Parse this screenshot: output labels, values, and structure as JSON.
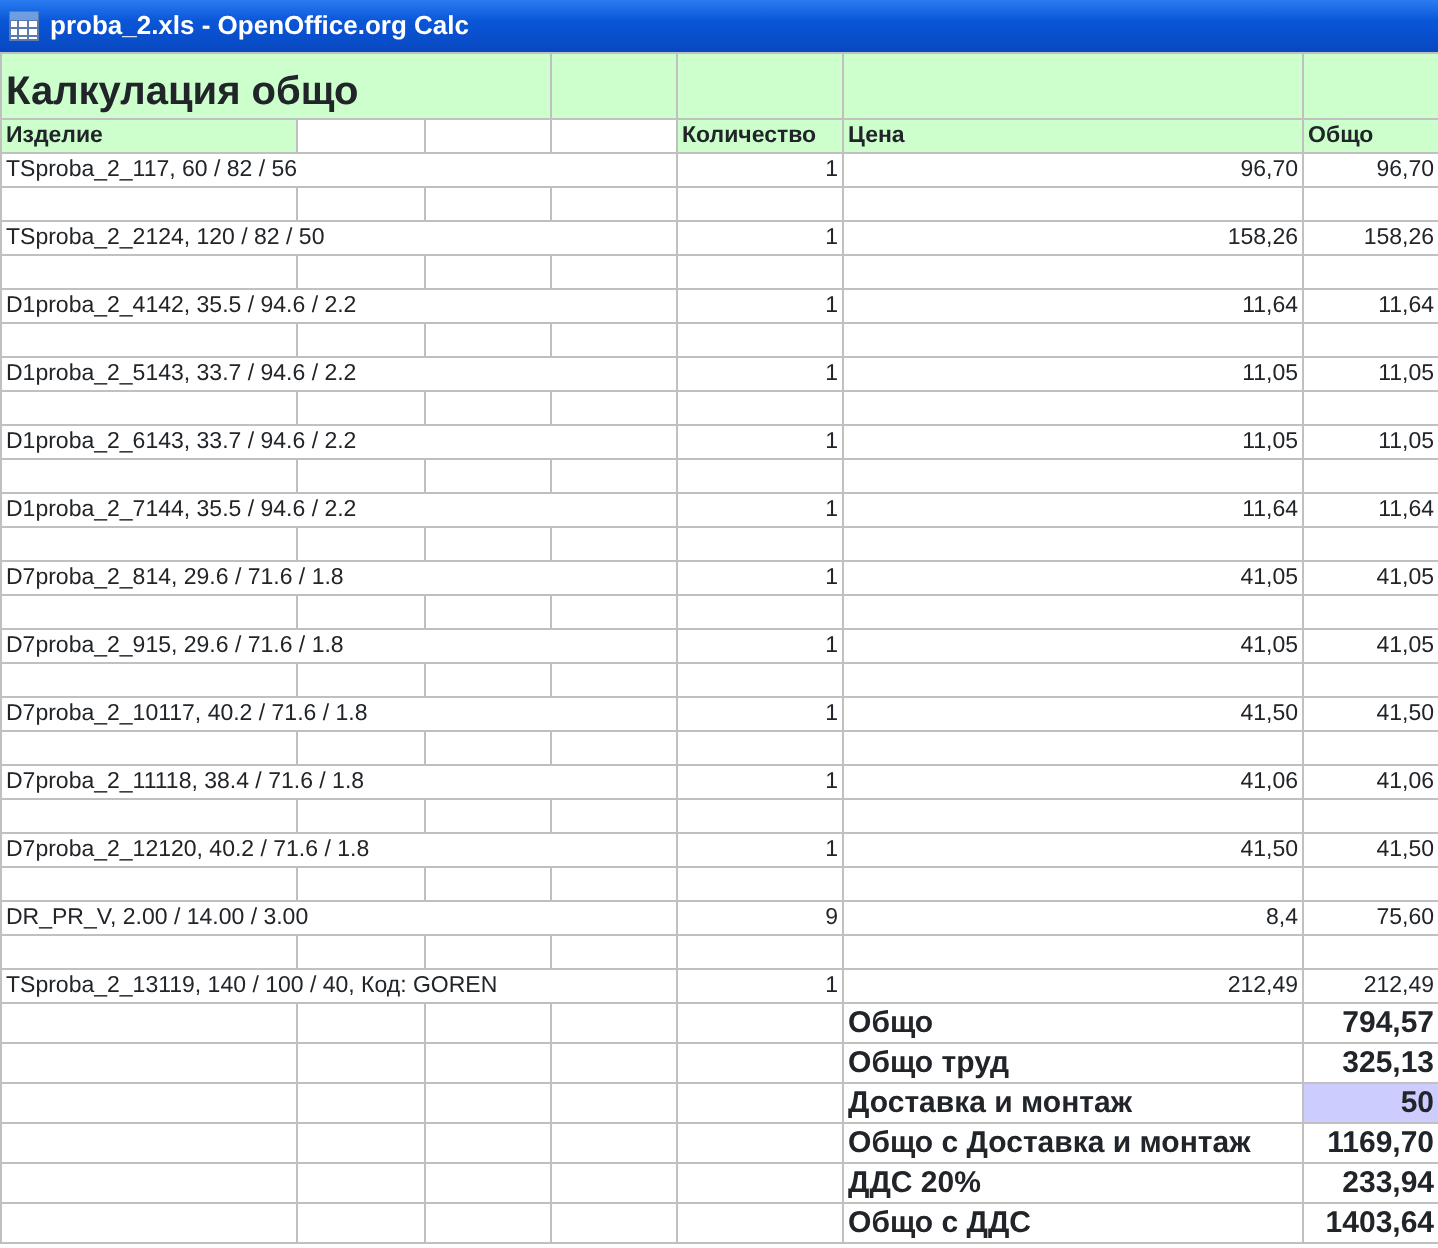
{
  "window": {
    "title": "proba_2.xls - OpenOffice.org Calc"
  },
  "sheet": {
    "title": "Калкулация общо",
    "header": {
      "item": "Изделие",
      "quantity": "Количество",
      "price": "Цена",
      "total": "Общо"
    },
    "items": [
      {
        "name": "TSproba_2_117, 60 / 82 / 56",
        "quantity": "1",
        "price": "96,70",
        "total": "96,70"
      },
      {
        "name": "TSproba_2_2124, 120 / 82 / 50",
        "quantity": "1",
        "price": "158,26",
        "total": "158,26"
      },
      {
        "name": "D1proba_2_4142, 35.5 / 94.6 / 2.2",
        "quantity": "1",
        "price": "11,64",
        "total": "11,64"
      },
      {
        "name": "D1proba_2_5143, 33.7 / 94.6 / 2.2",
        "quantity": "1",
        "price": "11,05",
        "total": "11,05"
      },
      {
        "name": "D1proba_2_6143, 33.7 / 94.6 / 2.2",
        "quantity": "1",
        "price": "11,05",
        "total": "11,05"
      },
      {
        "name": "D1proba_2_7144, 35.5 / 94.6 / 2.2",
        "quantity": "1",
        "price": "11,64",
        "total": "11,64"
      },
      {
        "name": "D7proba_2_814, 29.6 / 71.6 / 1.8",
        "quantity": "1",
        "price": "41,05",
        "total": "41,05"
      },
      {
        "name": "D7proba_2_915, 29.6 / 71.6 / 1.8",
        "quantity": "1",
        "price": "41,05",
        "total": "41,05"
      },
      {
        "name": "D7proba_2_10117, 40.2 / 71.6 / 1.8",
        "quantity": "1",
        "price": "41,50",
        "total": "41,50"
      },
      {
        "name": "D7proba_2_11118, 38.4 / 71.6 / 1.8",
        "quantity": "1",
        "price": "41,06",
        "total": "41,06"
      },
      {
        "name": "D7proba_2_12120, 40.2 / 71.6 / 1.8",
        "quantity": "1",
        "price": "41,50",
        "total": "41,50"
      },
      {
        "name": "DR_PR_V, 2.00 / 14.00 / 3.00",
        "quantity": "9",
        "price": "8,4",
        "total": "75,60"
      },
      {
        "name": "TSproba_2_13119, 140 / 100 / 40, Код: GOREN",
        "quantity": "1",
        "price": "212,49",
        "total": "212,49"
      }
    ],
    "summary": [
      {
        "label": "Общо",
        "value": "794,57",
        "highlighted": false
      },
      {
        "label": "Общо труд",
        "value": "325,13",
        "highlighted": false
      },
      {
        "label": "Доставка и монтаж",
        "value": "50",
        "highlighted": true
      },
      {
        "label": "Общо с Доставка и монтаж",
        "value": "1169,70",
        "highlighted": false
      },
      {
        "label": "ДДС 20%",
        "value": "233,94",
        "highlighted": false
      },
      {
        "label": "Общо с ДДС",
        "value": "1403,64",
        "highlighted": false
      }
    ]
  }
}
